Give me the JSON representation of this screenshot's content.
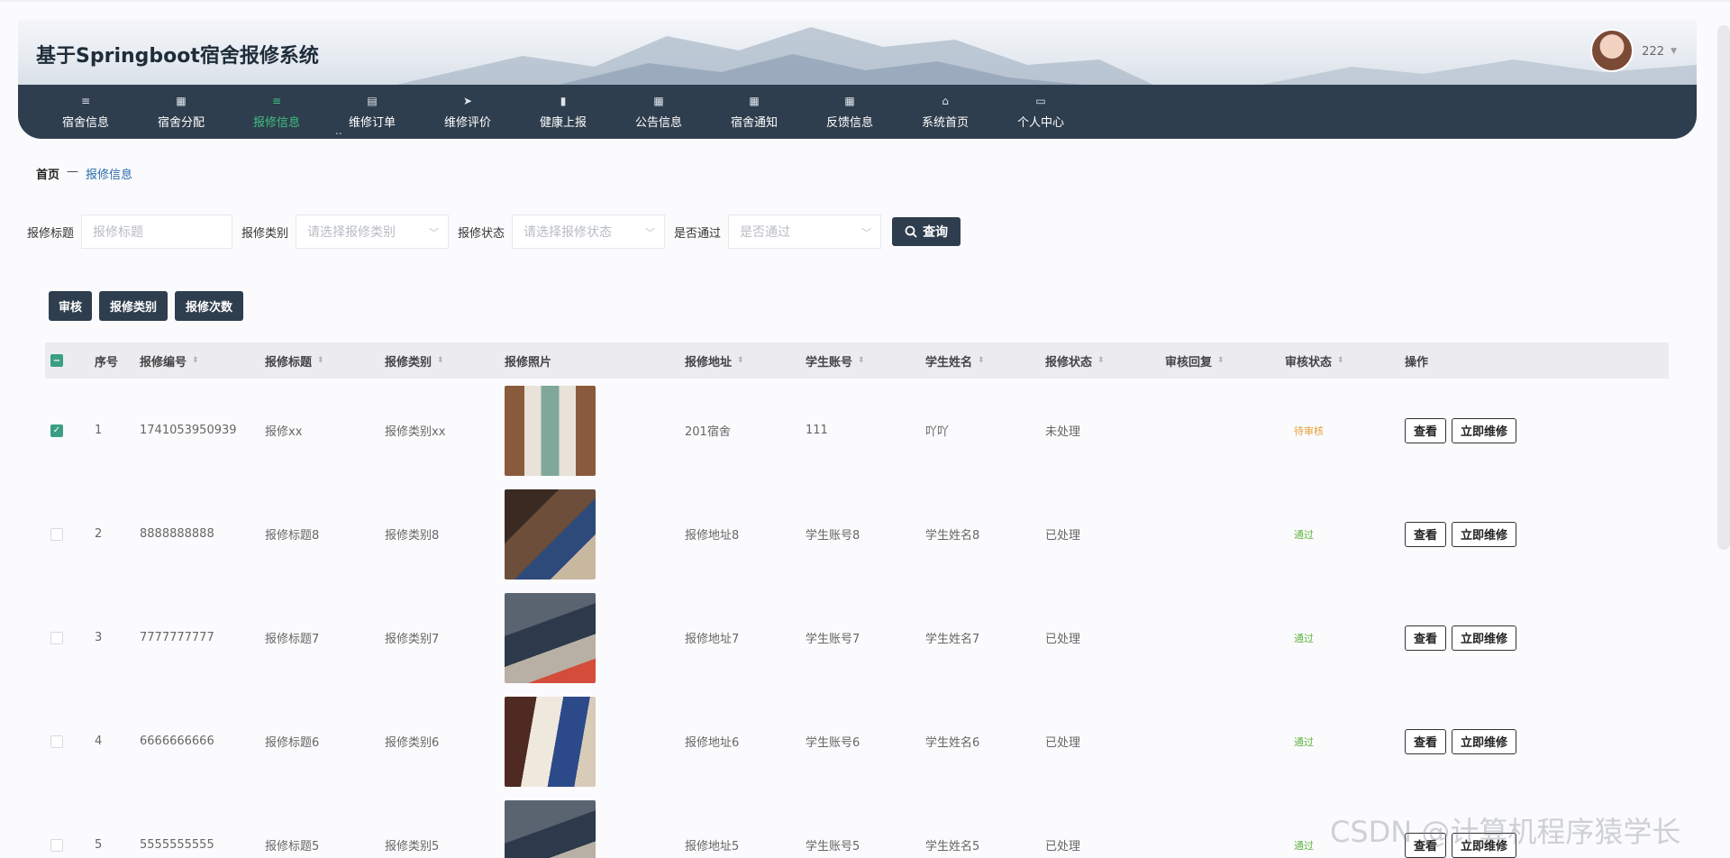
{
  "header": {
    "site_title": "基于Springboot宿舍报修系统",
    "username": "222"
  },
  "nav": [
    {
      "label": "宿舍信息",
      "icon": "list-icon"
    },
    {
      "label": "宿舍分配",
      "icon": "grid-icon"
    },
    {
      "label": "报修信息",
      "icon": "list-icon",
      "active": true
    },
    {
      "label": "维修订单",
      "icon": "clipboard-icon"
    },
    {
      "label": "维修评价",
      "icon": "send-icon"
    },
    {
      "label": "健康上报",
      "icon": "bar-chart-icon"
    },
    {
      "label": "公告信息",
      "icon": "grid-icon"
    },
    {
      "label": "宿舍通知",
      "icon": "grid-icon"
    },
    {
      "label": "反馈信息",
      "icon": "grid-icon"
    },
    {
      "label": "系统首页",
      "icon": "home-icon"
    },
    {
      "label": "个人中心",
      "icon": "card-icon"
    }
  ],
  "nav_dots": "..",
  "breadcrumb": {
    "home": "首页",
    "sep": "—",
    "current": "报修信息"
  },
  "search": {
    "title_label": "报修标题",
    "title_placeholder": "报修标题",
    "category_label": "报修类别",
    "category_placeholder": "请选择报修类别",
    "status_label": "报修状态",
    "status_placeholder": "请选择报修状态",
    "pass_label": "是否通过",
    "pass_placeholder": "是否通过",
    "query_label": "查询"
  },
  "actions": {
    "review": "审核",
    "category": "报修类别",
    "count": "报修次数"
  },
  "table": {
    "headers": {
      "index": "序号",
      "code": "报修编号",
      "title": "报修标题",
      "category": "报修类别",
      "photo": "报修照片",
      "address": "报修地址",
      "student_account": "学生账号",
      "student_name": "学生姓名",
      "repair_status": "报修状态",
      "review_reply": "审核回复",
      "review_status": "审核状态",
      "ops": "操作"
    },
    "view_label": "查看",
    "repair_label": "立即维修",
    "rows": [
      {
        "index": "1",
        "code": "1741053950939",
        "title": "报修xx",
        "category": "报修类别xx",
        "address": "201宿舍",
        "student_account": "111",
        "student_name": "吖吖",
        "repair_status": "未处理",
        "review_reply": "",
        "review_status": "待审核",
        "checked": true
      },
      {
        "index": "2",
        "code": "8888888888",
        "title": "报修标题8",
        "category": "报修类别8",
        "address": "报修地址8",
        "student_account": "学生账号8",
        "student_name": "学生姓名8",
        "repair_status": "已处理",
        "review_reply": "",
        "review_status": "通过",
        "checked": false
      },
      {
        "index": "3",
        "code": "7777777777",
        "title": "报修标题7",
        "category": "报修类别7",
        "address": "报修地址7",
        "student_account": "学生账号7",
        "student_name": "学生姓名7",
        "repair_status": "已处理",
        "review_reply": "",
        "review_status": "通过",
        "checked": false
      },
      {
        "index": "4",
        "code": "6666666666",
        "title": "报修标题6",
        "category": "报修类别6",
        "address": "报修地址6",
        "student_account": "学生账号6",
        "student_name": "学生姓名6",
        "repair_status": "已处理",
        "review_reply": "",
        "review_status": "通过",
        "checked": false
      },
      {
        "index": "5",
        "code": "5555555555",
        "title": "报修标题5",
        "category": "报修类别5",
        "address": "报修地址5",
        "student_account": "学生账号5",
        "student_name": "学生姓名5",
        "repair_status": "已处理",
        "review_reply": "",
        "review_status": "通过",
        "checked": false
      }
    ]
  },
  "watermark": "CSDN @计算机程序猿学长",
  "colors": {
    "primary": "#2f3e4e",
    "active_nav": "#3fbf7f",
    "pending": "#e4a03c",
    "pass": "#5fb341",
    "checkbox": "#3a9e84"
  }
}
